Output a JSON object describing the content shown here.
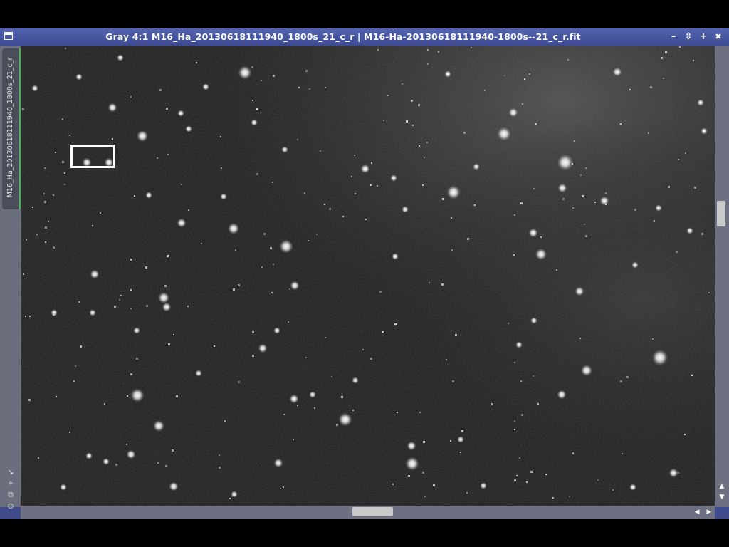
{
  "window": {
    "title": "Gray 4:1 M16_Ha_20130618111940_1800s_21_c_r | M16-Ha-20130618111940-1800s--21_c_r.fit",
    "view_tab_label": "M16_Ha_20130618111940_1800s_21_c_r",
    "colors": {
      "titlebar": "#4a58a2",
      "frame": "#3f4a8a",
      "tab_accent": "#3bbf4a"
    }
  },
  "titlebar_buttons": {
    "minimize": "–",
    "shade": "⇳",
    "maximize": "+",
    "close": "✖"
  },
  "sidebar_icons": [
    "zoom-fit-icon",
    "pin-icon",
    "clone-icon",
    "target-icon"
  ],
  "scrollbars": {
    "vertical_position": 0.35,
    "horizontal_position": 0.5
  }
}
